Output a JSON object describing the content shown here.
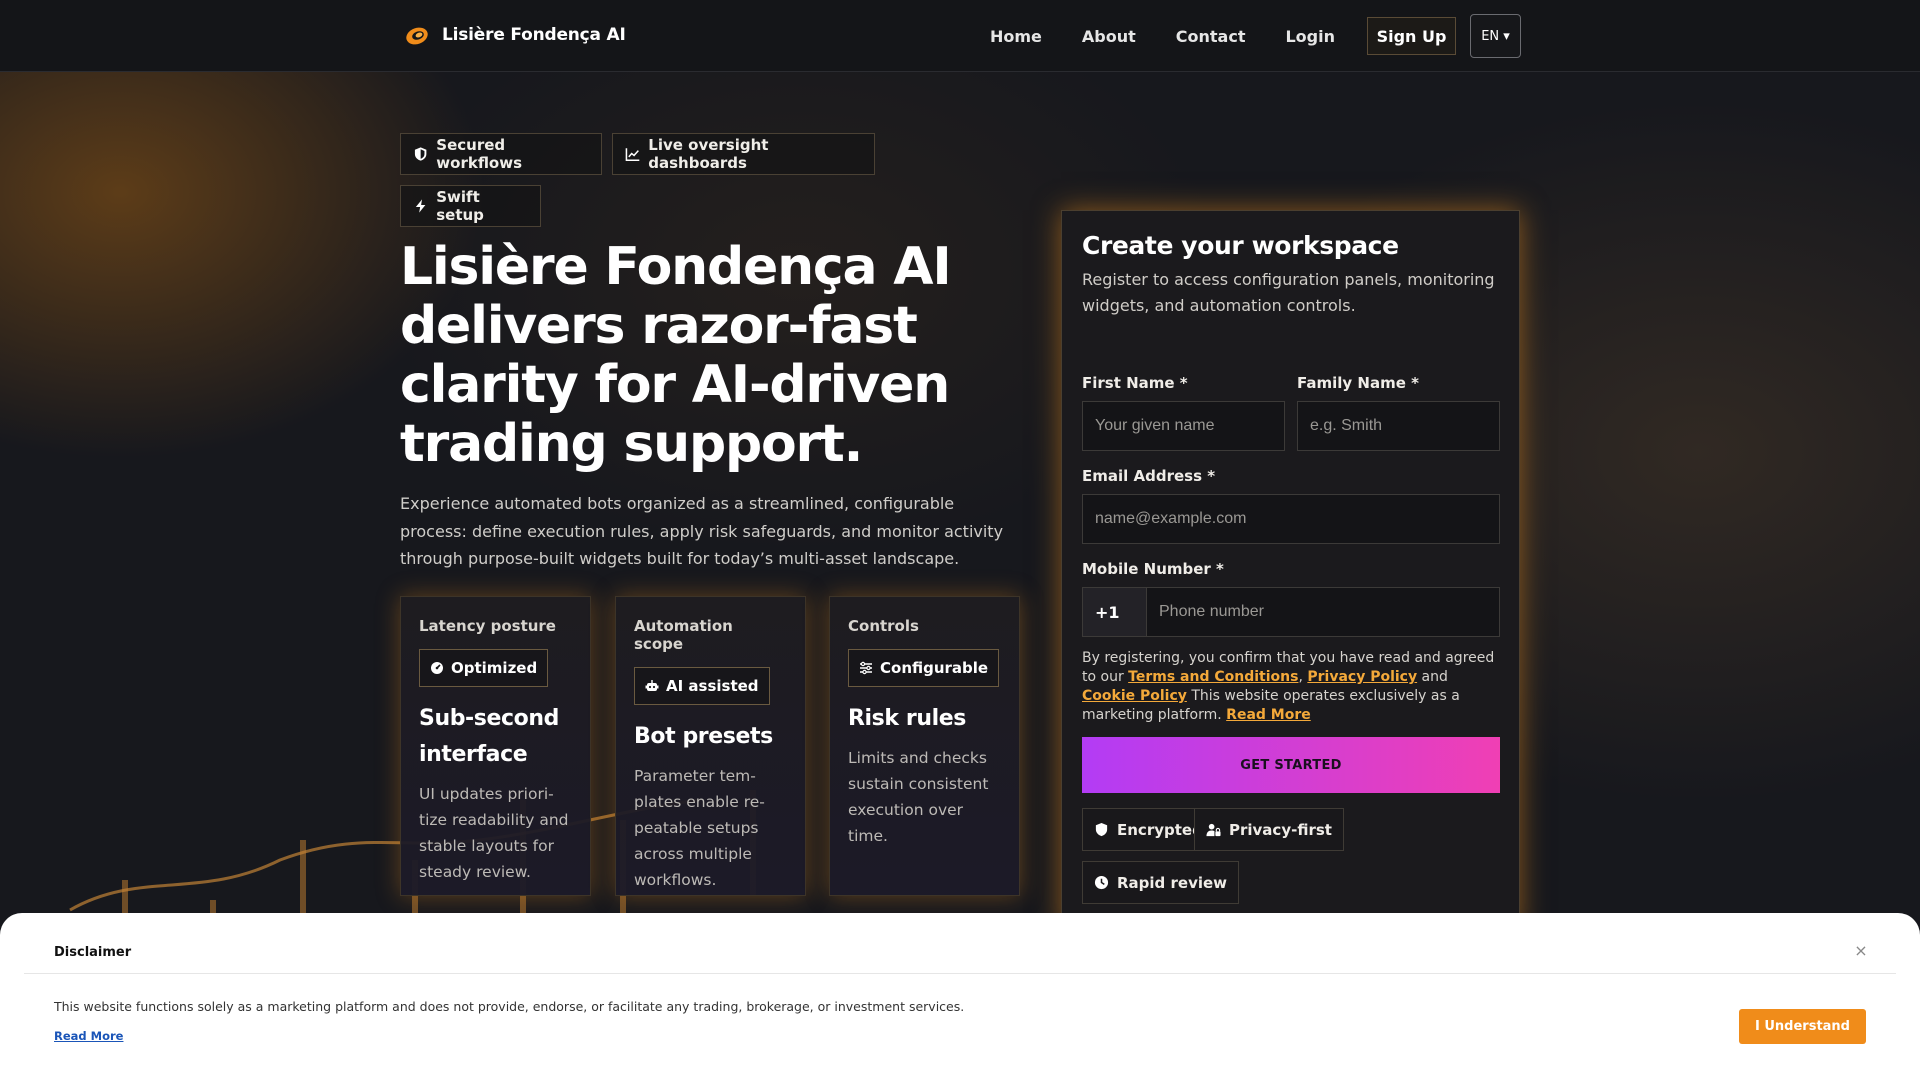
{
  "brand": {
    "name": "Lisière Fondença AI",
    "accent": "#f08c1a"
  },
  "nav": {
    "links": [
      "Home",
      "About",
      "Contact",
      "Login"
    ],
    "signup_label": "Sign Up",
    "lang_label": "EN ▾"
  },
  "badges": [
    {
      "icon": "shield-icon",
      "label": "Secured workflows"
    },
    {
      "icon": "chart-line-icon",
      "label": "Live oversight dashboards"
    },
    {
      "icon": "bolt-icon",
      "label": "Swift setup"
    }
  ],
  "hero": {
    "title": "Lisière Fondença AI delivers razor-fast clarity for AI-driven trading support.",
    "description": "Experience automated bots organized as a streamlined, configurable process: define execution rules, apply risk safeguards, and monitor activity through purpose-built widgets built for today’s multi-asset landscape."
  },
  "cards": [
    {
      "kicker": "Latency posture",
      "tag_icon": "gauge-icon",
      "tag": "Optimized",
      "title": "Sub-second interface",
      "body": "UI updates priori-tize readability and stable layouts for steady review."
    },
    {
      "kicker": "Automation scope",
      "tag_icon": "robot-icon",
      "tag": "AI assisted",
      "title": "Bot presets",
      "body": "Parameter tem-plates enable re-peatable setups across multiple workflows."
    },
    {
      "kicker": "Controls",
      "tag_icon": "sliders-icon",
      "tag": "Configurable",
      "title": "Risk rules",
      "body": "Limits and checks sustain consistent execution over time."
    }
  ],
  "form": {
    "title": "Create your workspace",
    "subtitle": "Register to access configuration panels, monitoring widgets, and automation controls.",
    "first_name_label": "First Name *",
    "first_name_placeholder": "Your given name",
    "family_name_label": "Family Name *",
    "family_name_placeholder": "e.g. Smith",
    "email_label": "Email Address *",
    "email_placeholder": "name@example.com",
    "mobile_label": "Mobile Number *",
    "phone_prefix": "+1",
    "phone_placeholder": "Phone number",
    "legal_prefix": "By registering, you confirm that you have read and agreed to our ",
    "terms": "Terms and Conditions",
    "comma": ", ",
    "privacy": "Privacy Policy",
    "and": " and ",
    "cookie": "Cookie Policy",
    "legal_suffix": " This website operates exclusively as a marketing platform. ",
    "read_more": "Read More",
    "cta": "GET STARTED",
    "cta_gradient": [
      "#b33cf5",
      "#f03fb4"
    ],
    "trust": [
      {
        "icon": "shield-icon",
        "label": "Encrypted"
      },
      {
        "icon": "user-lock-icon",
        "label": "Privacy-first"
      },
      {
        "icon": "clock-icon",
        "label": "Rapid review"
      }
    ]
  },
  "disclaimer": {
    "title": "Disclaimer",
    "close": "×",
    "text": "This website functions solely as a marketing platform and does not provide, endorse, or facilitate any trading, brokerage, or investment services.",
    "read_more": "Read More",
    "button": "I Understand"
  }
}
